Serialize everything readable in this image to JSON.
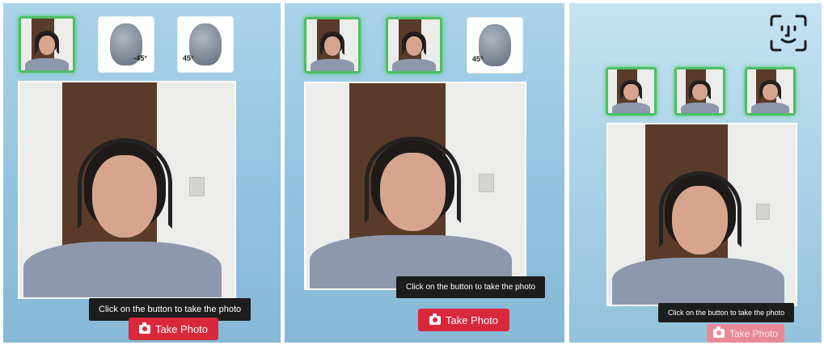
{
  "panels": [
    {
      "tooltip": "Click on the button to take the photo",
      "button_label": "Take Photo",
      "thumbnails": [
        {
          "state": "captured",
          "icon": "captured-photo"
        },
        {
          "state": "pending",
          "icon": "head-turn-left-icon",
          "angle_label": "-45°"
        },
        {
          "state": "pending",
          "icon": "head-turn-right-icon",
          "angle_label": "45°"
        }
      ]
    },
    {
      "tooltip": "Click on the button to take the photo",
      "button_label": "Take Photo",
      "thumbnails": [
        {
          "state": "captured",
          "icon": "captured-photo"
        },
        {
          "state": "captured",
          "icon": "captured-photo"
        },
        {
          "state": "pending",
          "icon": "head-turn-right-icon",
          "angle_label": "45°"
        }
      ]
    },
    {
      "tooltip": "Click on the button to take the photo",
      "button_label": "Take Photo",
      "button_disabled": true,
      "thumbnails": [
        {
          "state": "captured",
          "icon": "captured-photo"
        },
        {
          "state": "captured",
          "icon": "captured-photo"
        },
        {
          "state": "captured",
          "icon": "captured-photo"
        }
      ],
      "status_icon": "face-id-icon"
    }
  ],
  "colors": {
    "accent": "#d9273c",
    "captured_border": "#4cbf64",
    "panel_bg": "#9ccbe3",
    "tooltip_bg": "#1d1d1d"
  }
}
